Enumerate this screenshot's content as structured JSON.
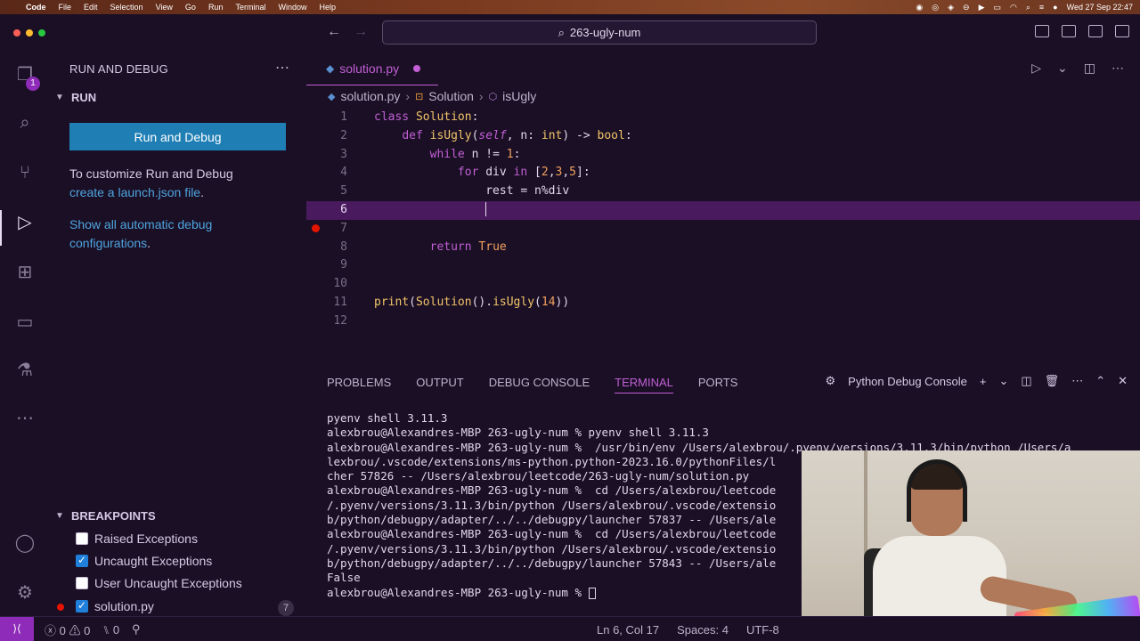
{
  "menubar": {
    "app": "Code",
    "items": [
      "File",
      "Edit",
      "Selection",
      "View",
      "Go",
      "Run",
      "Terminal",
      "Window",
      "Help"
    ],
    "datetime": "Wed 27 Sep  22:47"
  },
  "titlebar": {
    "search_text": "263-ugly-num"
  },
  "activity": {
    "explorer_badge": "1"
  },
  "sidebar": {
    "title": "RUN AND DEBUG",
    "run_section": "RUN",
    "run_button": "Run and Debug",
    "customize_text": "To customize Run and Debug",
    "launch_link": "create a launch.json file",
    "launch_suffix": ".",
    "show_configs_link": "Show all automatic debug configurations",
    "show_configs_suffix": ".",
    "breakpoints_section": "BREAKPOINTS",
    "breakpoints": [
      {
        "label": "Raised Exceptions",
        "checked": false
      },
      {
        "label": "Uncaught Exceptions",
        "checked": true
      },
      {
        "label": "User Uncaught Exceptions",
        "checked": false
      },
      {
        "label": "solution.py",
        "checked": true
      }
    ],
    "breakpoint_count": "7"
  },
  "editor": {
    "tab_name": "solution.py",
    "breadcrumb": [
      "solution.py",
      "Solution",
      "isUgly"
    ],
    "line_numbers": [
      "1",
      "2",
      "3",
      "4",
      "5",
      "6",
      "7",
      "8",
      "9",
      "10",
      "11",
      "12"
    ]
  },
  "panel": {
    "tabs": [
      "PROBLEMS",
      "OUTPUT",
      "DEBUG CONSOLE",
      "TERMINAL",
      "PORTS"
    ],
    "active_tab": "TERMINAL",
    "console_name": "Python Debug Console",
    "terminal_lines": [
      "pyenv shell 3.11.3",
      "alexbrou@Alexandres-MBP 263-ugly-num % pyenv shell 3.11.3",
      "alexbrou@Alexandres-MBP 263-ugly-num %  /usr/bin/env /Users/alexbrou/.pyenv/versions/3.11.3/bin/python /Users/a",
      "lexbrou/.vscode/extensions/ms-python.python-2023.16.0/pythonFiles/l",
      "cher 57826 -- /Users/alexbrou/leetcode/263-ugly-num/solution.py",
      "alexbrou@Alexandres-MBP 263-ugly-num %  cd /Users/alexbrou/leetcode",
      "/.pyenv/versions/3.11.3/bin/python /Users/alexbrou/.vscode/extensio",
      "b/python/debugpy/adapter/../../debugpy/launcher 57837 -- /Users/ale",
      "alexbrou@Alexandres-MBP 263-ugly-num %  cd /Users/alexbrou/leetcode",
      "/.pyenv/versions/3.11.3/bin/python /Users/alexbrou/.vscode/extensio",
      "b/python/debugpy/adapter/../../debugpy/launcher 57843 -- /Users/ale",
      "False"
    ],
    "prompt": "alexbrou@Alexandres-MBP 263-ugly-num % "
  },
  "statusbar": {
    "errors": "0",
    "warnings": "0",
    "ports": "0",
    "cursor_pos": "Ln 6, Col 17",
    "indent": "Spaces: 4",
    "encoding": "UTF-8"
  },
  "colors": {
    "accent": "#c25fd6",
    "button": "#1f7fb5",
    "background": "#1a0f24",
    "breakpoint": "#e51400"
  }
}
